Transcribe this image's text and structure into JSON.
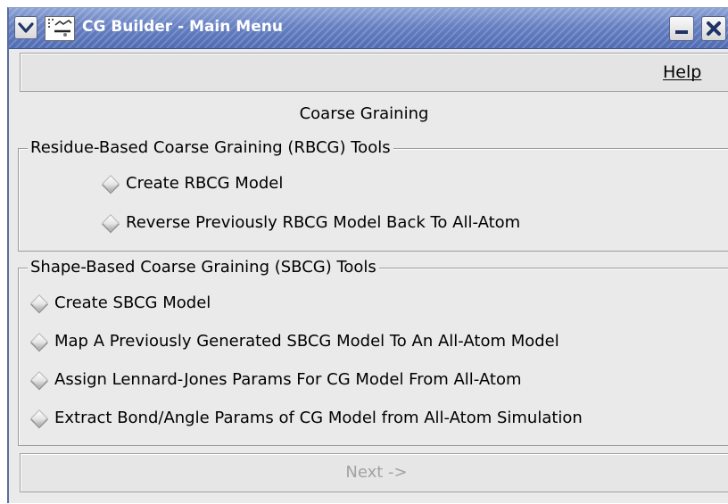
{
  "window": {
    "title": "CG Builder - Main Menu"
  },
  "menubar": {
    "help_label": "Help"
  },
  "main": {
    "heading": "Coarse Graining",
    "rbcg_group": {
      "legend": "Residue-Based Coarse Graining (RBCG) Tools",
      "options": [
        "Create RBCG Model",
        "Reverse Previously RBCG Model Back To All-Atom"
      ]
    },
    "sbcg_group": {
      "legend": "Shape-Based Coarse Graining (SBCG) Tools",
      "options": [
        "Create SBCG Model",
        "Map A Previously Generated SBCG Model To An All-Atom Model",
        "Assign Lennard-Jones Params For CG Model From All-Atom",
        "Extract Bond/Angle Params of CG Model from All-Atom Simulation"
      ]
    },
    "next_button": {
      "label": "Next ->",
      "state": "disabled"
    }
  },
  "colors": {
    "titlebar": "#6680c2",
    "window_bg": "#eaeaea",
    "disabled_text": "#a2a2a2"
  },
  "icons": {
    "window_menu": "chevron-down-icon",
    "app": "app-icon",
    "minimize": "minimize-icon",
    "close": "close-icon",
    "radio": "radio-diamond-icon"
  }
}
